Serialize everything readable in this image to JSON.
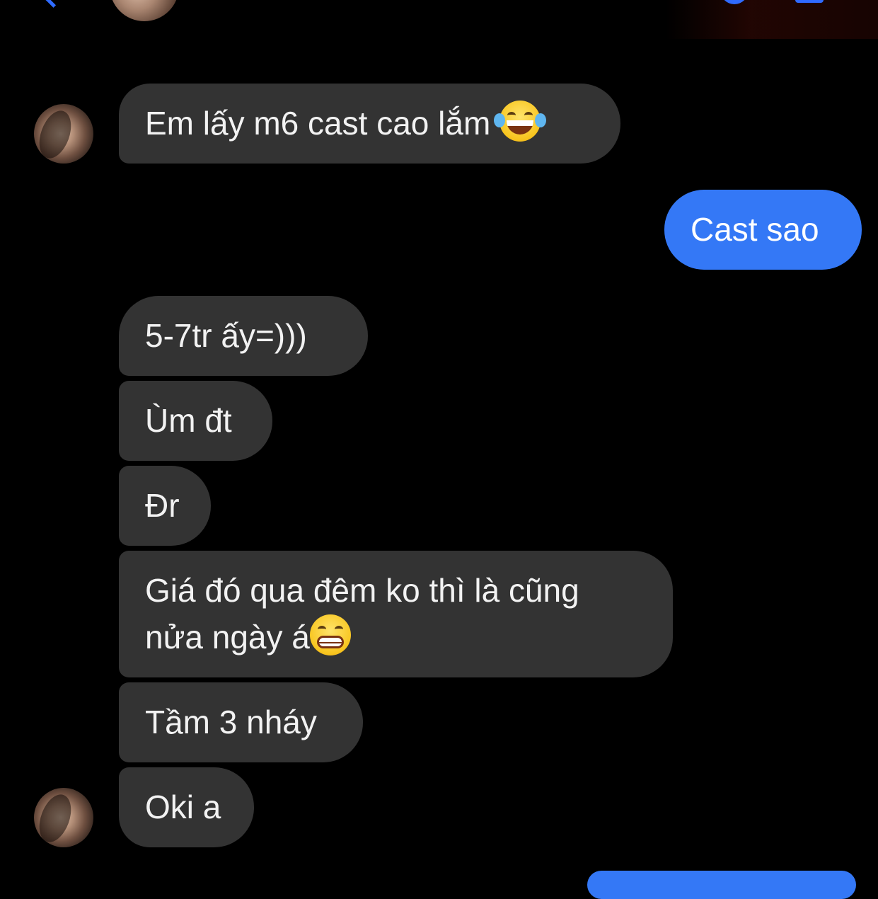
{
  "header": {
    "back_icon": "chevron-left-icon",
    "call_icon": "phone-icon",
    "video_icon": "video-icon",
    "accent_color": "#2f6bff"
  },
  "conversation": {
    "incoming_bubble_color": "#333333",
    "outgoing_bubble_color": "#3478f6",
    "messages": [
      {
        "direction": "incoming",
        "text": "Em lấy m6 cast cao lắm",
        "emoji": "face-with-tears-of-joy"
      },
      {
        "direction": "outgoing",
        "text": "Cast sao"
      },
      {
        "direction": "incoming",
        "text": "5-7tr ấy=)))"
      },
      {
        "direction": "incoming",
        "text": "Ùm đt"
      },
      {
        "direction": "incoming",
        "text": "Đr"
      },
      {
        "direction": "incoming",
        "line1": "Giá đó qua đêm ko thì là cũng",
        "line2": "nửa ngày á",
        "emoji": "grinning-face-with-smiling-eyes"
      },
      {
        "direction": "incoming",
        "text": "Tầm 3 nháy"
      },
      {
        "direction": "incoming",
        "text": "Oki a"
      }
    ]
  }
}
